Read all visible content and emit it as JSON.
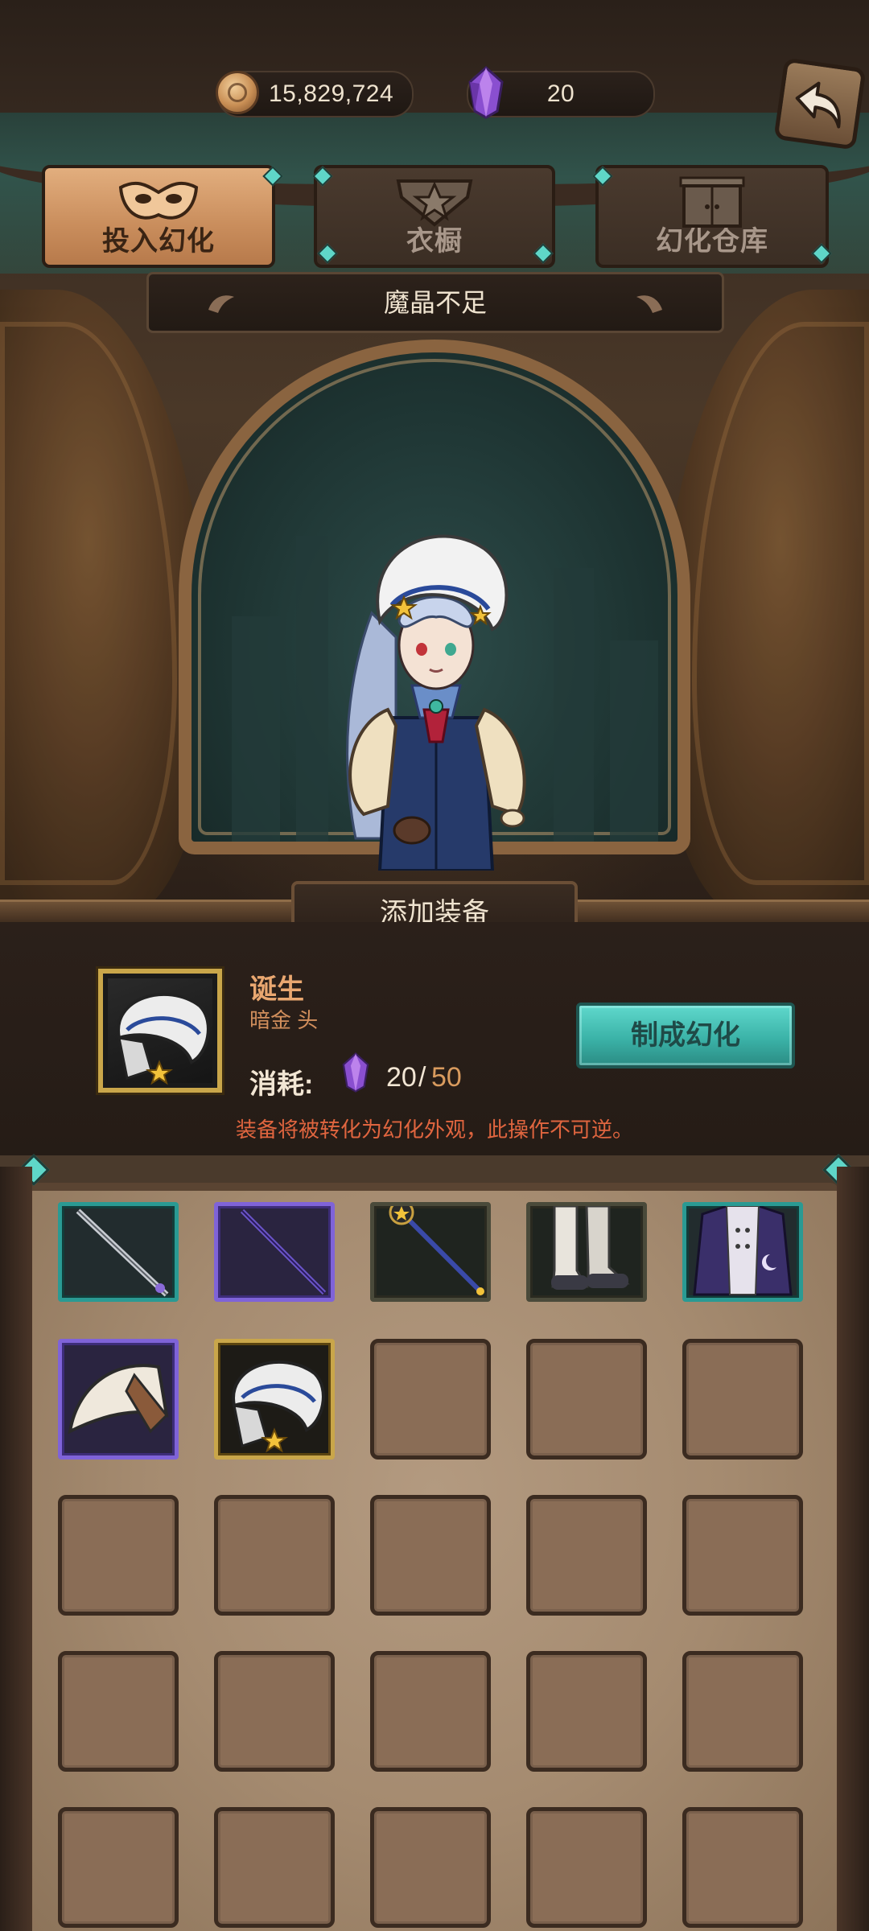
{
  "currency": {
    "gold": {
      "icon": "gold-coin-icon",
      "value": "15,829,724"
    },
    "crystal": {
      "icon": "purple-crystal-icon",
      "value": "20"
    }
  },
  "header": {
    "back_icon": "back-arrow-icon"
  },
  "tabs": [
    {
      "label": "投入幻化",
      "icon": "mask-icon",
      "active": true
    },
    {
      "label": "衣橱",
      "icon": "wardrobe-icon",
      "active": false
    },
    {
      "label": "幻化仓库",
      "icon": "cabinet-icon",
      "active": false
    }
  ],
  "status": {
    "message": "魔晶不足"
  },
  "character": {
    "add_equipment_label": "添加装备"
  },
  "selected_item": {
    "name": "诞生",
    "subtitle": "暗金 头",
    "cost_label": "消耗:",
    "cost_have": "20",
    "cost_separator": "/",
    "cost_need": "50",
    "craft_button_label": "制成幻化",
    "warning": "装备将被转化为幻化外观，此操作不可逆。"
  },
  "inventory": {
    "rows": 5,
    "columns": 5,
    "items": [
      {
        "name": "silver-staff-icon",
        "rarity": "teal"
      },
      {
        "name": "dark-spear-icon",
        "rarity": "purple"
      },
      {
        "name": "star-scepter-icon",
        "rarity": "dark"
      },
      {
        "name": "boots-icon",
        "rarity": "dark"
      },
      {
        "name": "robe-icon",
        "rarity": "teal"
      },
      {
        "name": "white-hat-icon",
        "rarity": "purple"
      },
      {
        "name": "bonnet-icon",
        "rarity": "gold"
      }
    ]
  },
  "colors": {
    "accent_teal": "#5fd6c8",
    "warning": "#e0653f",
    "item_name": "#e9a770",
    "cost_need": "#d99b5e",
    "tab_active": "#c98d5c"
  }
}
